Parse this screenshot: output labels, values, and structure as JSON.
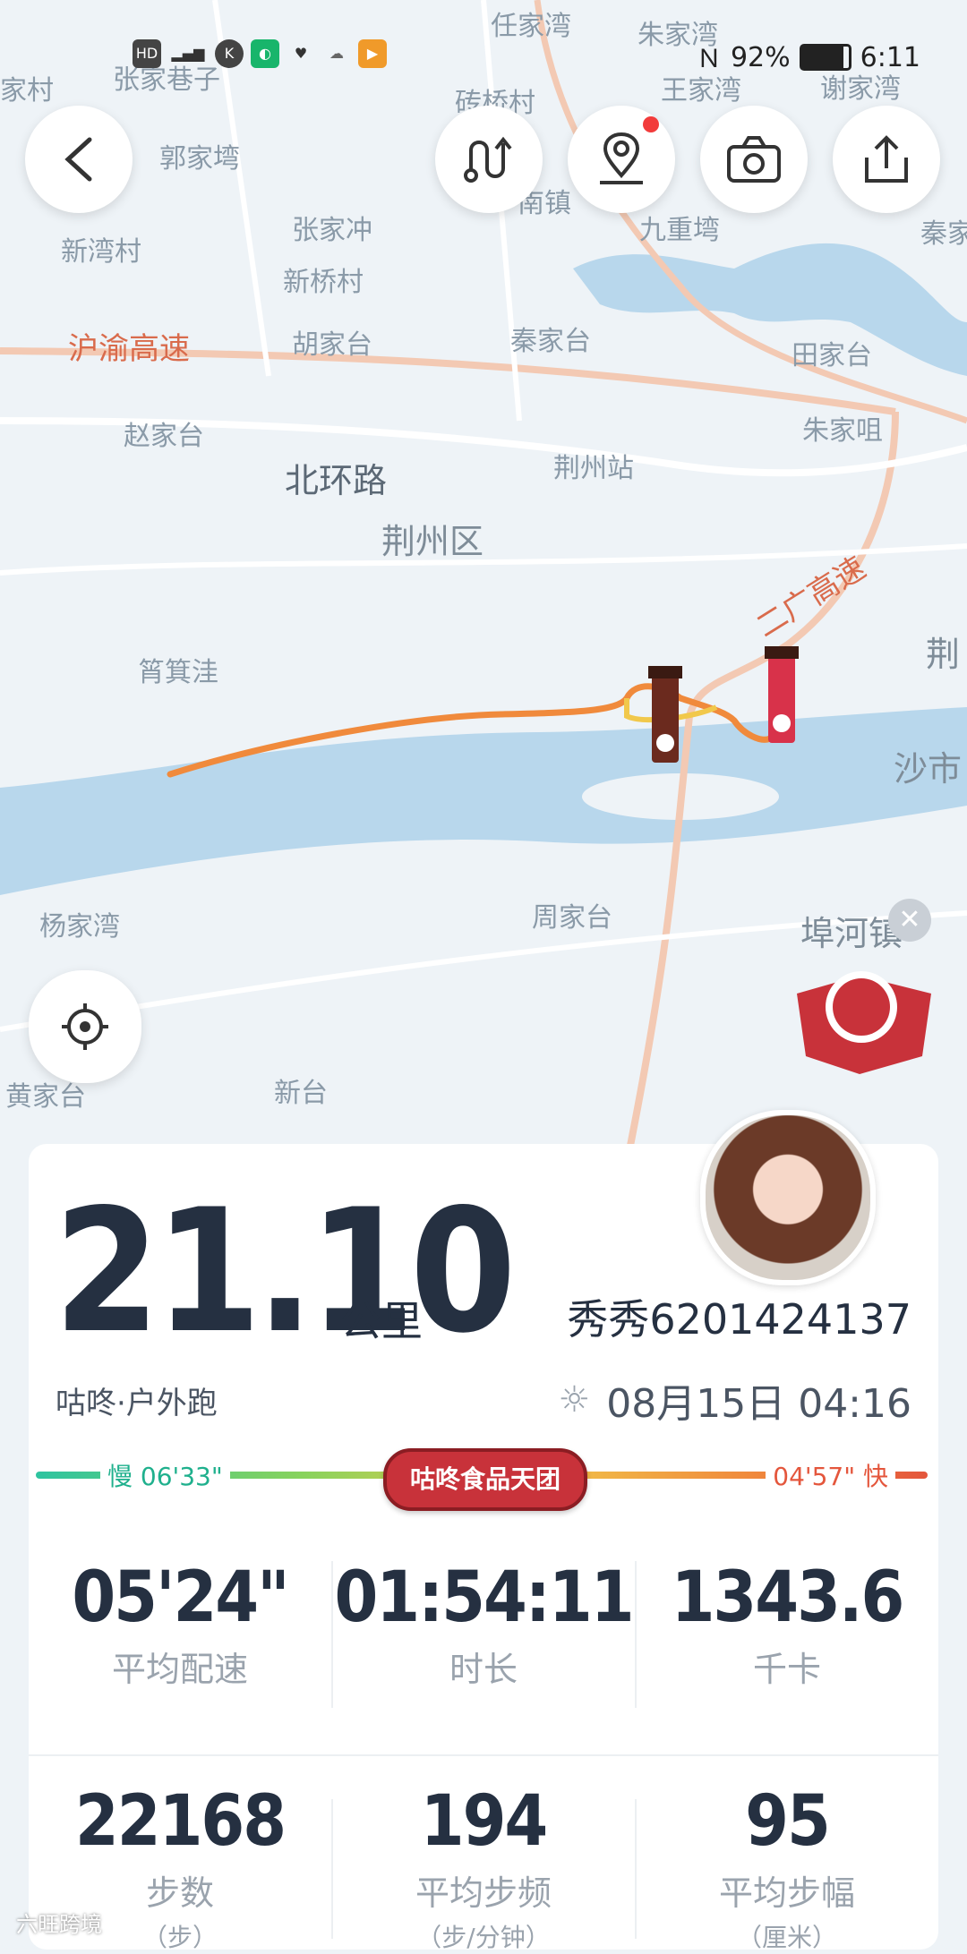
{
  "status_bar": {
    "left_icons": [
      "HD",
      "4G",
      "signal",
      "K",
      "app-green",
      "health",
      "cloud",
      "play"
    ],
    "battery": "92%",
    "time": "6:11"
  },
  "map_labels": {
    "renjiawan": "任家湾",
    "zhujiawan": "朱家湾",
    "jiacun": "家村",
    "zhangjiagang": "张家巷子",
    "zhuanqiaocun": "砖桥村",
    "wangjiawan": "王家湾",
    "xiejiawan": "谢家湾",
    "guojiawan": "郭家塆",
    "jingzhou_town": "南镇",
    "jiuchongwan": "九重塆",
    "xinwancun": "新湾村",
    "zhangjiachong": "张家冲",
    "xinqiaocun": "新桥村",
    "qinjiatai_left": "秦家",
    "huyu_highway": "沪渝高速",
    "hujiatai": "胡家台",
    "qinjiatai": "秦家台",
    "tianjiatai": "田家台",
    "zhaojiatai": "赵家台",
    "zhujiazui": "朱家咀",
    "beihuanlu": "北环路",
    "jingzhouzhan": "荆州站",
    "jingzhouqu": "荆州区",
    "erguang_highway": "二广高速",
    "jing_right": "荆",
    "dianjiwa": "筲箕洼",
    "shashi": "沙市",
    "yangjiawan": "杨家湾",
    "zhoujiatai": "周家台",
    "buhe": "埠河镇",
    "huangjiatai": "黄家台",
    "xintai": "新台"
  },
  "summary": {
    "distance": "21.10",
    "distance_unit": "公里",
    "username": "秀秀6201424137",
    "activity_type": "咕咚·户外跑",
    "datetime": "08月15日 04:16",
    "pace_slow_label": "慢 06'33\"",
    "pace_fast_label": "04'57\" 快",
    "badge": "咕咚食品天团"
  },
  "stats": [
    {
      "value": "05'24\"",
      "label": "平均配速"
    },
    {
      "value": "01:54:11",
      "label": "时长"
    },
    {
      "value": "1343.6",
      "label": "千卡"
    },
    {
      "value": "22168",
      "label": "步数",
      "unit": "（步）"
    },
    {
      "value": "194",
      "label": "平均步频",
      "unit": "（步/分钟）"
    },
    {
      "value": "95",
      "label": "平均步幅",
      "unit": "（厘米）"
    }
  ],
  "watermark": "六旺跨境",
  "colors": {
    "accent_green": "#2ec4a0",
    "accent_red": "#e4563c",
    "route": "#f08a3c",
    "text_dark": "#253041"
  }
}
